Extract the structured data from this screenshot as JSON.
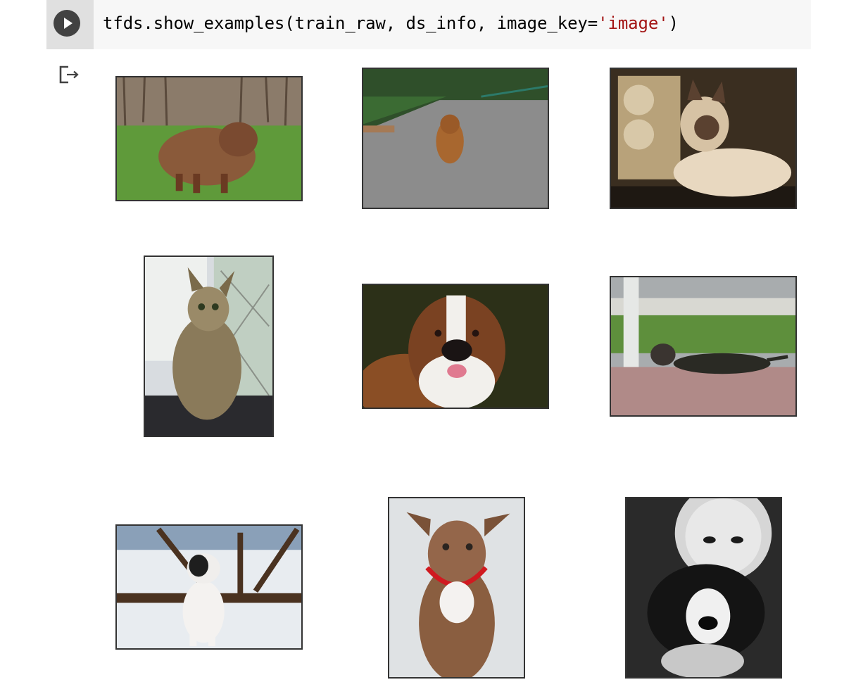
{
  "cell": {
    "code_prefix": "tfds.show_examples(train_raw, ds_info, image_key=",
    "code_string": "'image'",
    "code_suffix": ")",
    "run_icon": "play-icon",
    "output_icon": "output-redirect-icon"
  },
  "colors": {
    "cell_background": "#f7f7f7",
    "gutter_background": "#e0e0e0",
    "run_button": "#424242",
    "string_literal": "#a31515"
  },
  "images": [
    {
      "subject": "fluffy brown dog on grass"
    },
    {
      "subject": "spaniel running on road"
    },
    {
      "subject": "siamese cat lying down"
    },
    {
      "subject": "bengal cat sitting by window"
    },
    {
      "subject": "saint bernard dog"
    },
    {
      "subject": "cat lying on window cushion"
    },
    {
      "subject": "black and white puppy in snow"
    },
    {
      "subject": "brown puppy with red collar"
    },
    {
      "subject": "japanese chin dog with person"
    }
  ]
}
